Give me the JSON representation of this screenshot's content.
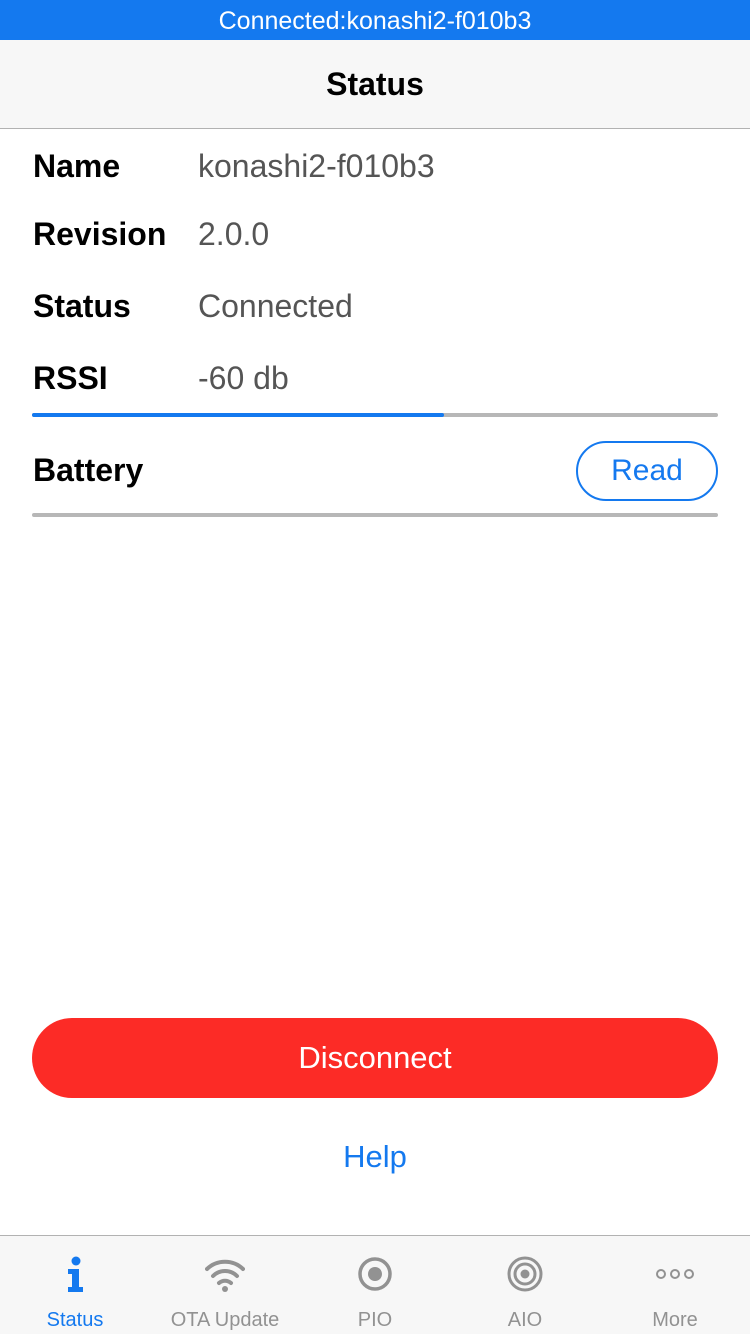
{
  "banner": {
    "text": "Connected:konashi2-f010b3"
  },
  "navbar": {
    "title": "Status"
  },
  "info": {
    "name_label": "Name",
    "name_value": "konashi2-f010b3",
    "revision_label": "Revision",
    "revision_value": "2.0.0",
    "status_label": "Status",
    "status_value": "Connected",
    "rssi_label": "RSSI",
    "rssi_value": "-60 db",
    "rssi_level_fraction": 0.6
  },
  "battery": {
    "label": "Battery",
    "read_label": "Read"
  },
  "actions": {
    "disconnect_label": "Disconnect",
    "help_label": "Help"
  },
  "tabbar": {
    "tabs": [
      {
        "label": "Status",
        "icon": "info-icon",
        "active": true
      },
      {
        "label": "OTA Update",
        "icon": "wifi-icon",
        "active": false
      },
      {
        "label": "PIO",
        "icon": "pio-icon",
        "active": false
      },
      {
        "label": "AIO",
        "icon": "aio-icon",
        "active": false
      },
      {
        "label": "More",
        "icon": "more-icon",
        "active": false
      }
    ]
  },
  "colors": {
    "accent": "#1479ef",
    "danger": "#fc2b26",
    "inactive": "#929292",
    "divider": "#b7b7b7"
  }
}
